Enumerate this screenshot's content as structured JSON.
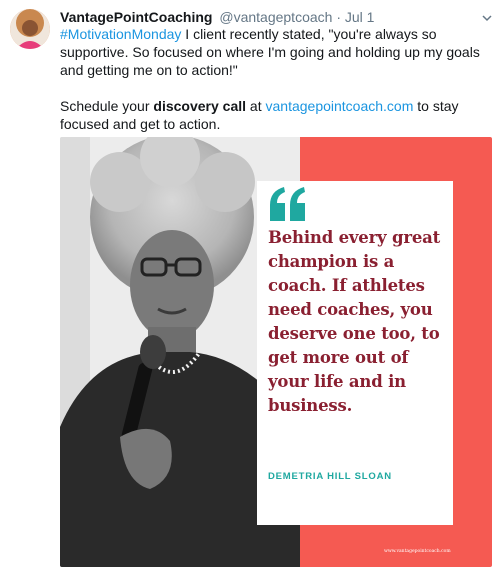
{
  "tweet": {
    "author_name": "VantagePointCoaching",
    "author_handle": "@vantageptcoach",
    "separator": "·",
    "date": "Jul 1",
    "text": {
      "hashtag": "#MotivationMonday",
      "line1_rest": " I client recently  stated, \"you're always so supportive. So focused on where I'm going and holding up my goals and getting me on to action!\"",
      "line2_before": "Schedule your ",
      "line2_bold": "discovery call",
      "line2_mid": " at ",
      "line2_link": "vantagepointcoach.com",
      "line2_after": " to stay focused and get to action."
    }
  },
  "media": {
    "quote": "Behind every great champion is a coach. If athletes need coaches, you deserve one too, to get more out of your life and in business.",
    "quote_author": "DEMETRIA HILL SLOAN",
    "site_url": "www.vantagepointcoach.com",
    "colors": {
      "panel": "#f55a52",
      "quote_text": "#8a2031",
      "quote_mark": "#1fa8a0",
      "author_text": "#1fa8a0"
    }
  },
  "icons": {
    "avatar": "avatar-photo",
    "caret": "chevron-down-icon",
    "quote_mark": "quote-mark-icon"
  }
}
